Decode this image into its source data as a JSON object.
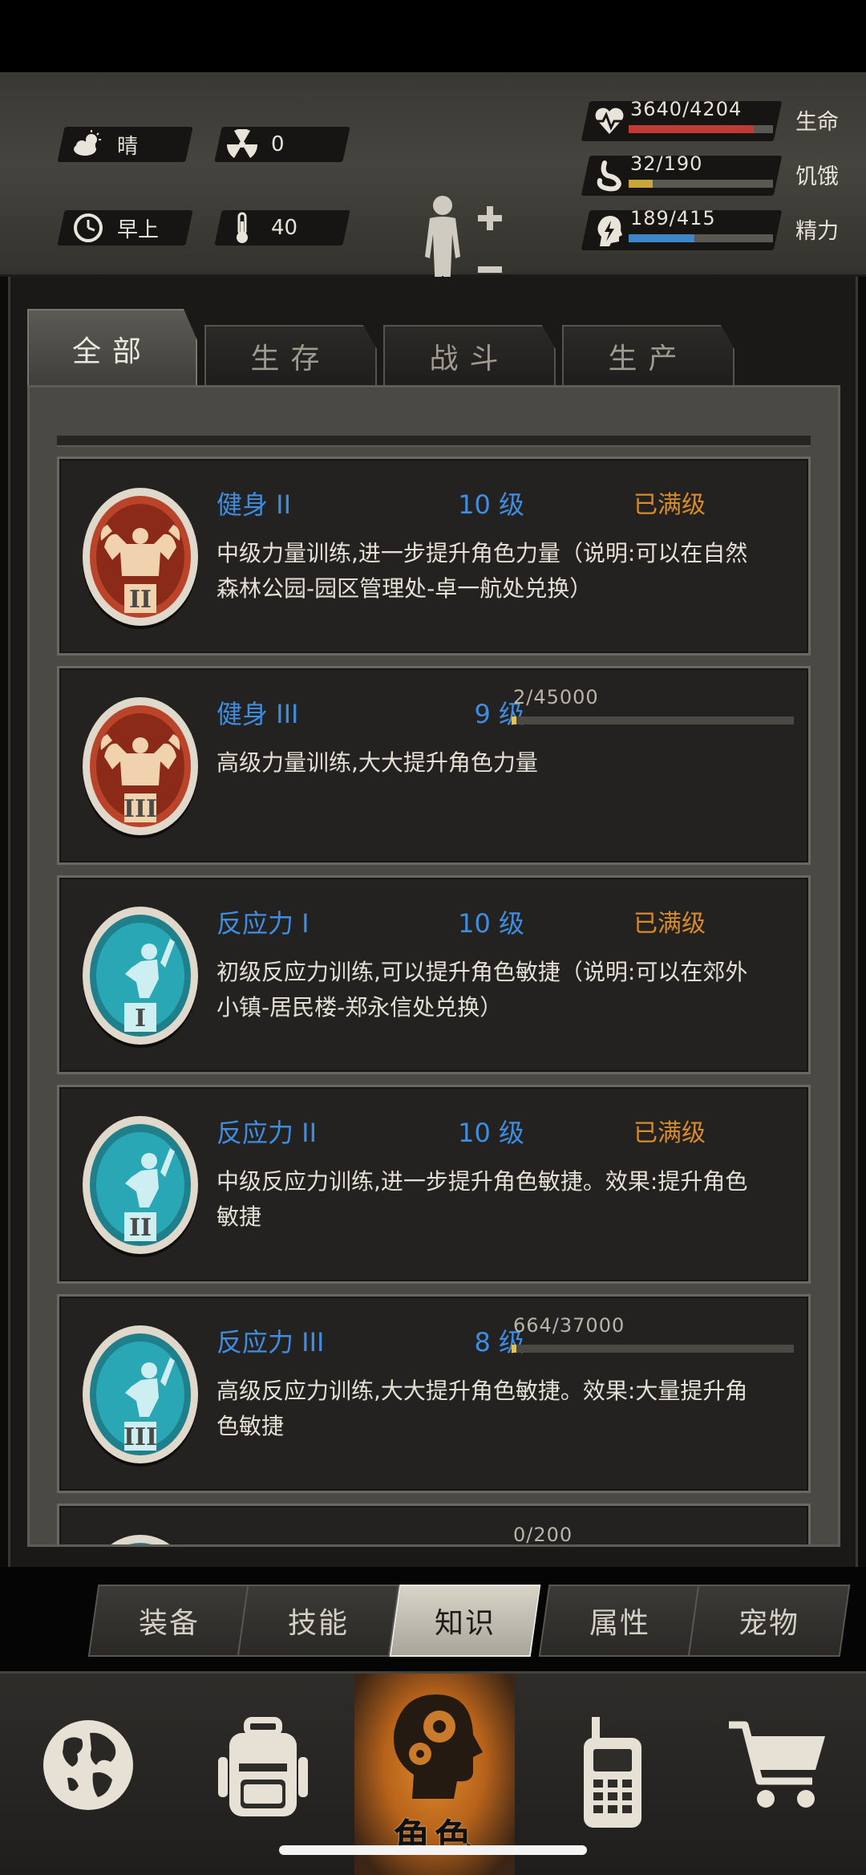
{
  "status": {
    "weather": "晴",
    "radiation": "0",
    "time_of_day": "早上",
    "temperature": "40"
  },
  "vitals": [
    {
      "label": "生命",
      "value": "3640/4204",
      "fraction": 0.866,
      "color": "#c23a34",
      "icon": "heart-pulse-icon"
    },
    {
      "label": "饥饿",
      "value": "32/190",
      "fraction": 0.168,
      "color": "#c9a63a",
      "icon": "stomach-icon"
    },
    {
      "label": "精力",
      "value": "189/415",
      "fraction": 0.455,
      "color": "#3f86c8",
      "icon": "energy-head-icon"
    }
  ],
  "tabs": [
    "全部",
    "生存",
    "战斗",
    "生产"
  ],
  "active_tab": "全部",
  "skills": [
    {
      "name": "健身 II",
      "level": "10 级",
      "status": "已满级",
      "progress": null,
      "progress_fraction": null,
      "desc": "中级力量训练,进一步提升角色力量（说明:可以在自然森林公园-园区管理处-卓一航处兑换）",
      "type": "strength",
      "roman": "II"
    },
    {
      "name": "健身 III",
      "level": "9 级",
      "status": "",
      "progress": "2/45000",
      "progress_fraction": 4e-05,
      "desc": "高级力量训练,大大提升角色力量",
      "type": "strength",
      "roman": "III"
    },
    {
      "name": "反应力 I",
      "level": "10 级",
      "status": "已满级",
      "progress": null,
      "progress_fraction": null,
      "desc": "初级反应力训练,可以提升角色敏捷（说明:可以在郊外小镇-居民楼-郑永信处兑换）",
      "type": "agility",
      "roman": "I"
    },
    {
      "name": "反应力 II",
      "level": "10 级",
      "status": "已满级",
      "progress": null,
      "progress_fraction": null,
      "desc": "中级反应力训练,进一步提升角色敏捷。效果:提升角色敏捷",
      "type": "agility",
      "roman": "II"
    },
    {
      "name": "反应力 III",
      "level": "8 级",
      "status": "",
      "progress": "664/37000",
      "progress_fraction": 0.018,
      "desc": "高级反应力训练,大大提升角色敏捷。效果:大量提升角色敏捷",
      "type": "agility",
      "roman": "III"
    },
    {
      "name": "",
      "level": "",
      "status": "",
      "progress": "0/200",
      "progress_fraction": 0,
      "desc": "",
      "type": "agility",
      "roman": ""
    }
  ],
  "subtabs": [
    "装备",
    "技能",
    "知识",
    "属性",
    "宠物"
  ],
  "active_subtab": "知识",
  "bottom_nav": [
    {
      "name": "globe",
      "label": ""
    },
    {
      "name": "backpack",
      "label": ""
    },
    {
      "name": "character",
      "label": "角色"
    },
    {
      "name": "radio",
      "label": ""
    },
    {
      "name": "shop",
      "label": ""
    }
  ]
}
